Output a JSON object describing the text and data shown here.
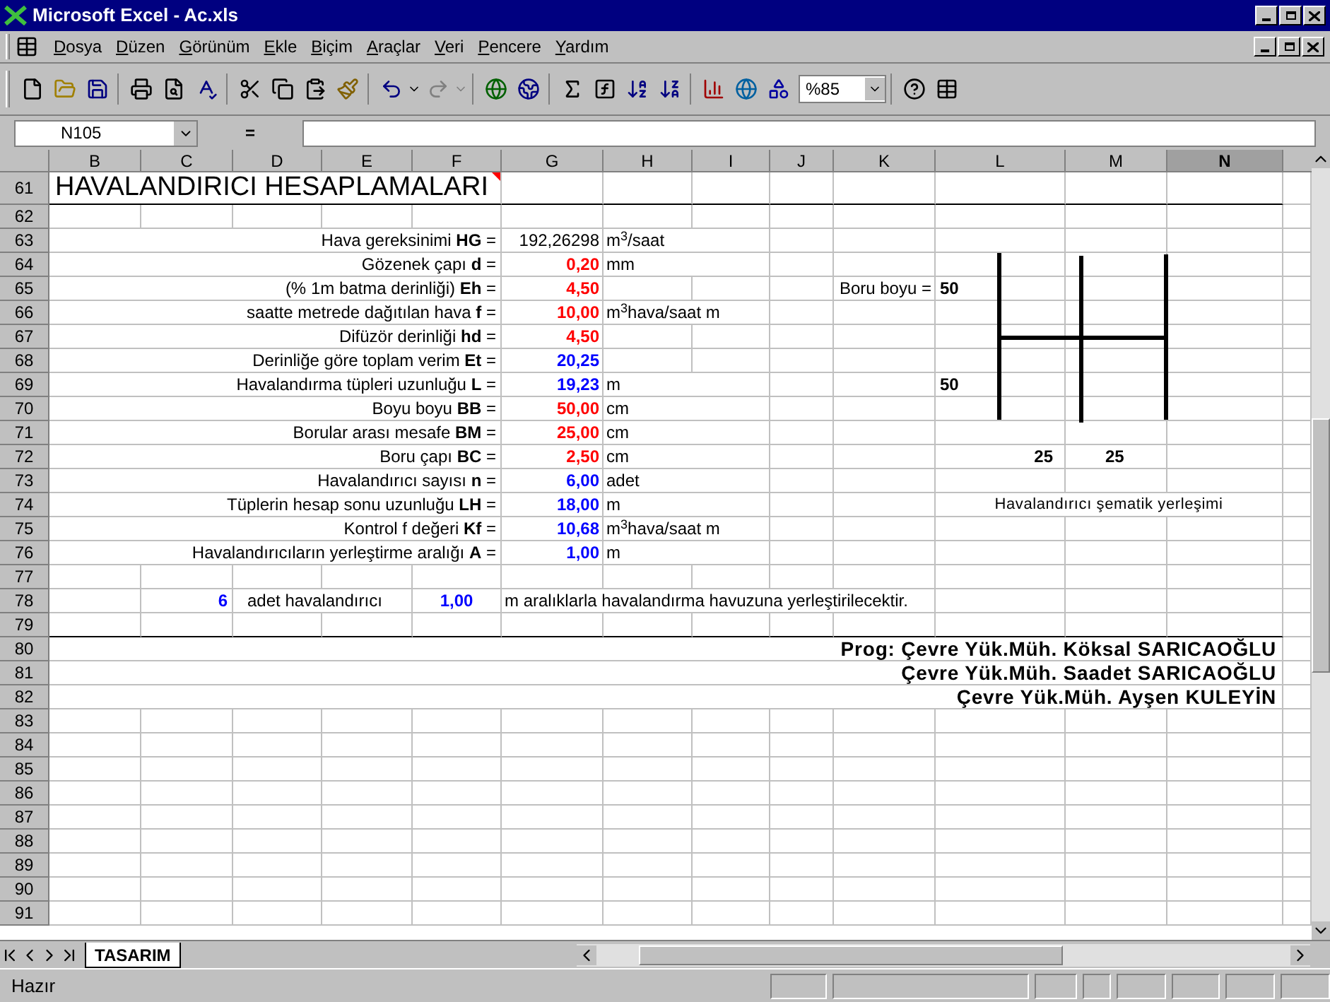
{
  "window": {
    "title": "Microsoft Excel - Ac.xls"
  },
  "menu": [
    "Dosya",
    "Düzen",
    "Görünüm",
    "Ekle",
    "Biçim",
    "Araçlar",
    "Veri",
    "Pencere",
    "Yardım"
  ],
  "toolbar": {
    "zoom": "%85"
  },
  "formula_bar": {
    "name_box": "N105",
    "equals": "="
  },
  "columns": [
    {
      "label": "B",
      "selected": false
    },
    {
      "label": "C",
      "selected": false
    },
    {
      "label": "D",
      "selected": false
    },
    {
      "label": "E",
      "selected": false
    },
    {
      "label": "F",
      "selected": false
    },
    {
      "label": "G",
      "selected": false
    },
    {
      "label": "H",
      "selected": false
    },
    {
      "label": "I",
      "selected": false
    },
    {
      "label": "J",
      "selected": false
    },
    {
      "label": "K",
      "selected": false
    },
    {
      "label": "L",
      "selected": false
    },
    {
      "label": "M",
      "selected": false
    },
    {
      "label": "N",
      "selected": true
    }
  ],
  "rows": [
    {
      "number": "61",
      "title": "HAVALANDIRICI HESAPLAMALARI"
    },
    {
      "number": "62"
    },
    {
      "number": "63",
      "parameter": {
        "label": "Hava gereksinimi **HG** =",
        "value": "192,26298",
        "unit": "m$^{3}$/saat",
        "kind": "plain"
      }
    },
    {
      "number": "64",
      "parameter": {
        "label": "Gözenek çapı  **d** =",
        "value": "0,20",
        "unit": "mm",
        "kind": "input"
      }
    },
    {
      "number": "65",
      "parameter": {
        "label": "(% 1m batma derinliği) **Eh** =",
        "value": "4,50",
        "kind": "input"
      },
      "diagram": {
        "kind": "length",
        "label": "Boru boyu =",
        "value": "50"
      }
    },
    {
      "number": "66",
      "parameter": {
        "label": "saatte metrede dağıtılan hava **f** =",
        "value": "10,00",
        "unit": "m$^{3}$hava/saat m",
        "kind": "input"
      }
    },
    {
      "number": "67",
      "parameter": {
        "label": "Difüzör derinliği **hd** =",
        "value": "4,50",
        "kind": "input"
      }
    },
    {
      "number": "68",
      "parameter": {
        "label": "Derinliğe göre toplam verim **Et** =",
        "value": "20,25",
        "kind": "result"
      }
    },
    {
      "number": "69",
      "parameter": {
        "label": "Havalandırma tüpleri uzunluğu **L** =",
        "value": "19,23",
        "unit": "m",
        "kind": "result"
      },
      "diagram": {
        "kind": "length",
        "value": "50"
      }
    },
    {
      "number": "70",
      "parameter": {
        "label": "Boyu boyu **BB** =",
        "value": "50,00",
        "unit": "cm",
        "kind": "input"
      }
    },
    {
      "number": "71",
      "parameter": {
        "label": "Borular arası mesafe **BM** =",
        "value": "25,00",
        "unit": "cm",
        "kind": "input"
      }
    },
    {
      "number": "72",
      "parameter": {
        "label": "Boru çapı **BC** =",
        "value": "2,50",
        "unit": "cm",
        "kind": "input"
      },
      "diagram": {
        "kind": "spacing",
        "values": [
          "25",
          "25"
        ]
      }
    },
    {
      "number": "73",
      "parameter": {
        "label": "Havalandırıcı sayısı **n** =",
        "value": "6,00",
        "unit": "adet",
        "kind": "result"
      }
    },
    {
      "number": "74",
      "parameter": {
        "label": "Tüplerin hesap sonu uzunluğu **LH** =",
        "value": "18,00",
        "unit": "m",
        "kind": "result"
      },
      "diagram": {
        "kind": "caption",
        "text": "Havalandırıcı şematik yerleşimi"
      }
    },
    {
      "number": "75",
      "parameter": {
        "label": "Kontrol f değeri **Kf** =",
        "value": "10,68",
        "unit": "m$^{3}$hava/saat m",
        "kind": "result"
      }
    },
    {
      "number": "76",
      "parameter": {
        "label": "Havalandırıcıların yerleştirme aralığı **A** =",
        "value": "1,00",
        "unit": "m",
        "kind": "result"
      }
    },
    {
      "number": "77"
    },
    {
      "number": "78",
      "summary": {
        "count": "6",
        "count_label": "adet havalandırıcı",
        "spacing": "1,00",
        "sentence": "m aralıklarla havalandırma havuzuna yerleştirilecektir."
      }
    },
    {
      "number": "79",
      "rule_below": true
    },
    {
      "number": "80",
      "credit": "Prog: Çevre Yük.Müh. Köksal SARICAOĞLU"
    },
    {
      "number": "81",
      "credit": "Çevre Yük.Müh. Saadet SARICAOĞLU"
    },
    {
      "number": "82",
      "credit": "Çevre Yük.Müh. Ayşen KULEYİN"
    },
    {
      "number": "83"
    },
    {
      "number": "84"
    },
    {
      "number": "85"
    },
    {
      "number": "86"
    },
    {
      "number": "87"
    },
    {
      "number": "88"
    },
    {
      "number": "89"
    },
    {
      "number": "90"
    },
    {
      "number": "91"
    }
  ],
  "sheet_tabs": [
    {
      "label": "TASARIM",
      "selected": true
    }
  ],
  "status_bar": {
    "text": "Hazır"
  }
}
